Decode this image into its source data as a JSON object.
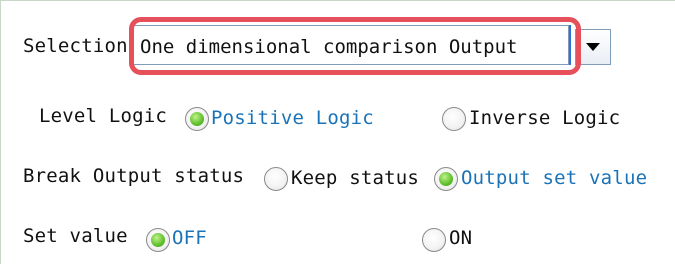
{
  "selection": {
    "label": "Selection",
    "value": "One dimensional comparison Output"
  },
  "level_logic": {
    "label": "Level Logic",
    "options": [
      "Positive Logic",
      "Inverse Logic"
    ],
    "selected": "Positive Logic"
  },
  "break_output": {
    "label": "Break Output status",
    "options": [
      "Keep status",
      "Output set value"
    ],
    "selected": "Output set value"
  },
  "set_value": {
    "label": "Set value",
    "options": [
      "OFF",
      "ON"
    ],
    "selected": "OFF"
  },
  "colors": {
    "highlight": "#e5505a",
    "radio_selected": "#5fbf2c",
    "selected_text": "#1a73b8"
  }
}
